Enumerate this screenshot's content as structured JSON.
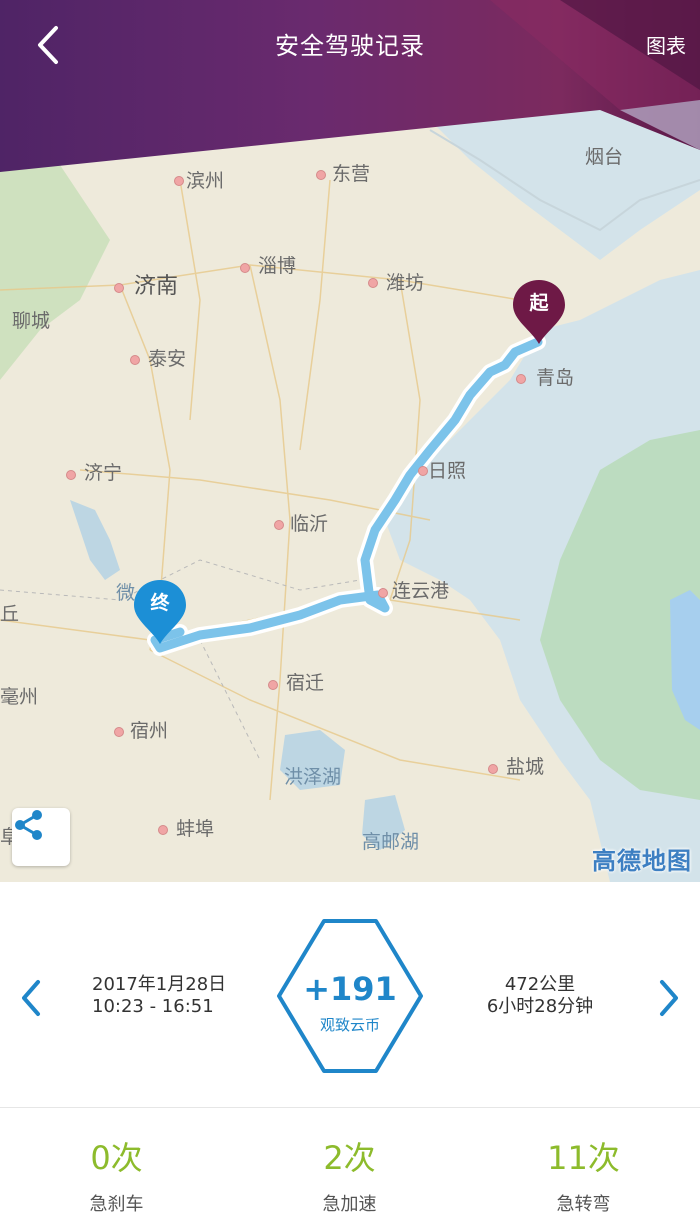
{
  "header": {
    "title": "安全驾驶记录",
    "chart_link": "图表"
  },
  "map": {
    "cities": {
      "binzhou": "滨州",
      "dongying": "东营",
      "yantai": "烟台",
      "jinan": "济南",
      "zibo": "淄博",
      "weifang": "潍坊",
      "liaocheng": "聊城",
      "taian": "泰安",
      "qingdao": "青岛",
      "jining": "济宁",
      "rizhao": "日照",
      "linyi": "临沂",
      "lianyungang": "连云港",
      "wei": "微",
      "qiu": "丘",
      "suqian": "宿迁",
      "suzhou": "宿州",
      "hongzehu": "洪泽湖",
      "yancheng": "盐城",
      "bengbu": "蚌埠",
      "gaoyouhu": "高邮湖",
      "zhou": "毫州",
      "fu": "阜"
    },
    "start_marker": "起",
    "end_marker": "终",
    "logo": "高德地图",
    "route_color": "#7cc3ea",
    "start_color": "#6e1946",
    "end_color": "#1c8fd6"
  },
  "trip": {
    "date": "2017年1月28日",
    "time": "10:23 - 16:51",
    "distance": "472公里",
    "duration": "6小时28分钟",
    "coins_value": "+191",
    "coins_label": "观致云币"
  },
  "stats": [
    {
      "value": "0次",
      "label": "急刹车"
    },
    {
      "value": "2次",
      "label": "急加速"
    },
    {
      "value": "11次",
      "label": "急转弯"
    }
  ],
  "colors": {
    "accent": "#1f86c9",
    "stat_green": "#8dbb2c",
    "header_purple": "#6a2a6e"
  }
}
